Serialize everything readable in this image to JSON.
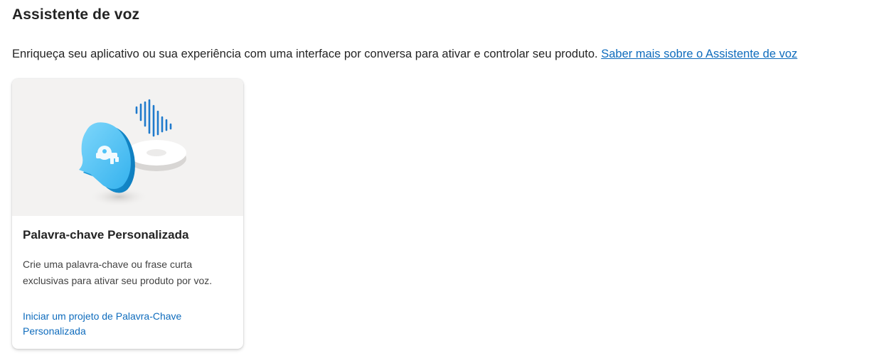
{
  "page": {
    "title": "Assistente de voz",
    "intro_text": "Enriqueça seu aplicativo ou sua experiência com uma interface por conversa para ativar e controlar seu produto. ",
    "intro_link": "Saber mais sobre o Assistente de voz"
  },
  "cards": [
    {
      "title": "Palavra-chave Personalizada",
      "description": "Crie uma palavra-chave ou frase curta exclusivas para ativar seu produto por voz.",
      "link": "Iniciar um projeto de Palavra-Chave Personalizada",
      "illustration_icon": "voice-assistant-illustration"
    }
  ],
  "colors": {
    "link": "#0f6cbd",
    "hero_background": "#f3f2f1",
    "bubble_blue": "#4fc3f7",
    "wave_blue": "#1f7acc"
  }
}
